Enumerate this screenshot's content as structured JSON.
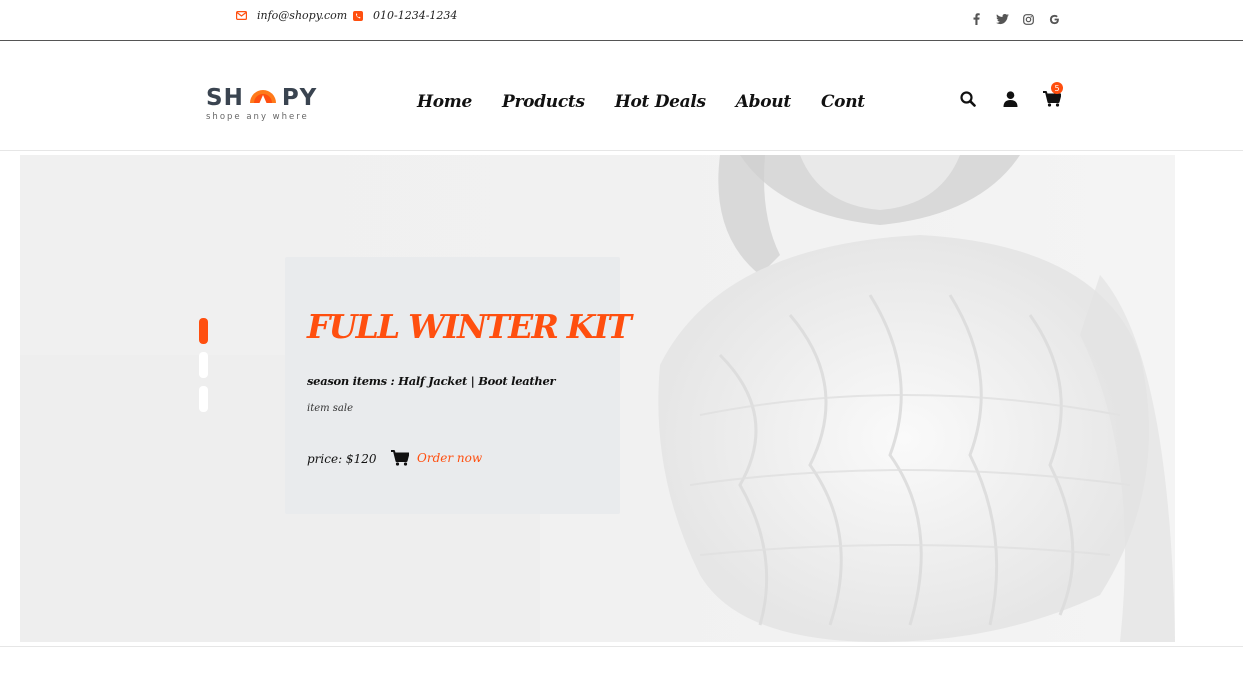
{
  "topbar": {
    "email": "info@shopy.com",
    "phone": "010-1234-1234",
    "social_icons": [
      "facebook-icon",
      "twitter-icon",
      "instagram-icon",
      "google-icon"
    ]
  },
  "header": {
    "logo": {
      "left": "SH",
      "right": "PY",
      "tagline": "shope any where"
    },
    "nav": [
      "Home",
      "Products",
      "Hot Deals",
      "About",
      "Cont"
    ],
    "cart_count": "5"
  },
  "hero": {
    "title": "FULL WINTER KIT",
    "items": "season items : Half Jacket | Boot leather",
    "sale": "item sale",
    "price": "price: $120",
    "order_label": "Order now",
    "slides": 3,
    "active_slide": 1
  },
  "colors": {
    "accent": "#ff4f0f",
    "text": "#111111",
    "logo": "#3a4450"
  }
}
